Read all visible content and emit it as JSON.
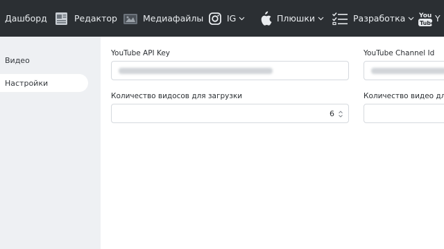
{
  "topnav": {
    "dashboard": "Дашборд",
    "editor": "Редактор",
    "media": "Медиафайлы",
    "ig": "IG",
    "plushki": "Плюшки",
    "development": "Разработка",
    "youtube_partial": "Y",
    "icons": [
      "dashboard-icon",
      "editor-icon",
      "media-icon",
      "instagram-icon",
      "apple-icon",
      "checklist-icon",
      "youtube-icon"
    ]
  },
  "sidebar": {
    "items": [
      {
        "label": "Видео",
        "active": false
      },
      {
        "label": "Настройки",
        "active": true
      }
    ]
  },
  "form": {
    "api_key_label": "YouTube API Key",
    "channel_id_label": "YouTube Channel Id",
    "count_label": "Количество видосов для загрузки",
    "count_value": "6",
    "count2_label": "Количество видео для о"
  },
  "colors": {
    "topbar": "#2b2f33",
    "sidebar": "#eef0f3",
    "content": "#ffffff",
    "border": "#d5d9de"
  }
}
